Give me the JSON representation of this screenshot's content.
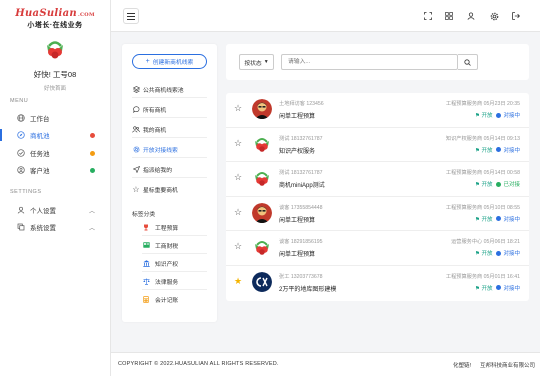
{
  "brand": {
    "logo": "HuaSulian",
    "logo_suffix": ".COM",
    "slogan": "小塔长·在线业务"
  },
  "user": {
    "greeting": "好快!",
    "job_no": "工号08",
    "sub": "好快首面"
  },
  "sidebar": {
    "menu_title": "MENU",
    "settings_title": "SETTINGS",
    "items": [
      {
        "label": "工作台",
        "icon": "globe-icon"
      },
      {
        "label": "商机池",
        "icon": "compass-icon",
        "dot": "#e74c3c"
      },
      {
        "label": "任务池",
        "icon": "check-circle-icon",
        "dot": "#f39c12"
      },
      {
        "label": "客户池",
        "icon": "user-circle-icon",
        "dot": "#27ae60"
      }
    ],
    "settings": [
      {
        "label": "个人设置",
        "icon": "user-icon"
      },
      {
        "label": "系统设置",
        "icon": "copy-icon"
      }
    ]
  },
  "categories": {
    "create_label": "创建新商机线索",
    "items": [
      {
        "label": "公共商机线索池",
        "icon": "layers-icon"
      },
      {
        "label": "所有商机",
        "icon": "chat-icon"
      },
      {
        "label": "我的商机",
        "icon": "users-icon"
      },
      {
        "label": "开放对接线索",
        "icon": "gear-icon"
      },
      {
        "label": "指派给我的",
        "icon": "send-icon"
      },
      {
        "label": "星标重要商机",
        "icon": "star-outline-icon"
      }
    ],
    "tag_title": "标签分类",
    "tags": [
      {
        "label": "工程预算",
        "icon": "trophy-icon",
        "color": "#e74c3c"
      },
      {
        "label": "工商财税",
        "icon": "card-icon",
        "color": "#27ae60"
      },
      {
        "label": "知识产权",
        "icon": "bank-icon",
        "color": "#2b6fe0"
      },
      {
        "label": "法律服务",
        "icon": "scale-icon",
        "color": "#2b6fe0"
      },
      {
        "label": "会计记账",
        "icon": "calculator-icon",
        "color": "#f39c12"
      }
    ]
  },
  "search": {
    "status_label": "按状态",
    "placeholder": "请输入..."
  },
  "list": [
    {
      "contact": "土地拜访客 123456",
      "title": "闲单工程预算",
      "meta": "工程预算服务商 05月23日 20:35",
      "open": "开放",
      "status": "对接中",
      "status_color": "#2b6fe0",
      "avatar": "person",
      "starred": false
    },
    {
      "contact": "测试 18132761787",
      "title": "知识产权服务",
      "meta": "知识产权服务商 05月14日 09:13",
      "open": "开放",
      "status": "对接中",
      "status_color": "#2b6fe0",
      "avatar": "fruit",
      "starred": false
    },
    {
      "contact": "测试 18132761787",
      "title": "商机miniApp测试",
      "meta": "工程预算服务商 05月14日 00:58",
      "open": "开放",
      "status": "已对接",
      "status_color": "#27ae60",
      "avatar": "fruit",
      "starred": false
    },
    {
      "contact": "谈客 17355854448",
      "title": "闲单工程预算",
      "meta": "工程预算服务商 05月10日 08:55",
      "open": "开放",
      "status": "对接中",
      "status_color": "#2b6fe0",
      "avatar": "person",
      "starred": false
    },
    {
      "contact": "谈客 18291856195",
      "title": "闲单工程预算",
      "meta": "运营服务中心 05月06日 18:21",
      "open": "开放",
      "status": "对接中",
      "status_color": "#2b6fe0",
      "avatar": "fruit",
      "starred": false
    },
    {
      "contact": "张工 13203773678",
      "title": "2万平的地库图形建模",
      "meta": "工程预算服务商 05月01日 16:41",
      "open": "开放",
      "status": "对接中",
      "status_color": "#2b6fe0",
      "avatar": "logo",
      "starred": true
    }
  ],
  "footer": {
    "copyright": "COPYRIGHT © 2022.HUASULIAN ALL RIGHTS RESERVED.",
    "link1": "化塑链!",
    "link2": "互邦科技商业有限公司"
  }
}
